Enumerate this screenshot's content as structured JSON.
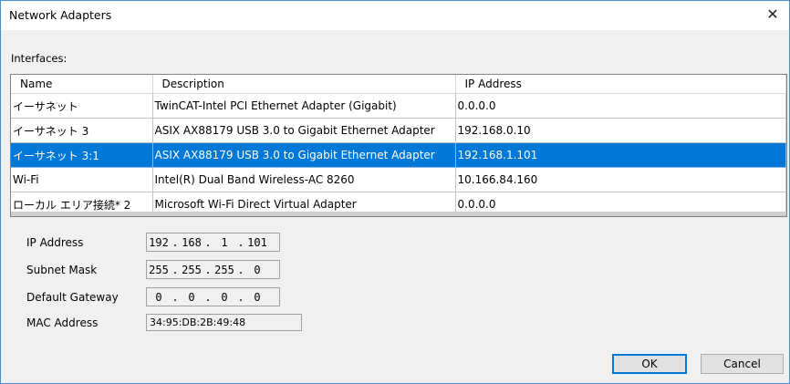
{
  "window": {
    "title": "Network Adapters",
    "close_glyph": "✕"
  },
  "interfaces": {
    "label": "Interfaces:",
    "columns": [
      "Name",
      "Description",
      "IP Address"
    ],
    "rows": [
      {
        "name": "イーサネット",
        "description": "TwinCAT-Intel PCI Ethernet Adapter (Gigabit)",
        "ip": "0.0.0.0",
        "selected": false
      },
      {
        "name": "イーサネット 3",
        "description": "ASIX AX88179 USB 3.0 to Gigabit Ethernet Adapter",
        "ip": "192.168.0.10",
        "selected": false
      },
      {
        "name": "イーサネット 3:1",
        "description": "ASIX AX88179 USB 3.0 to Gigabit Ethernet Adapter",
        "ip": "192.168.1.101",
        "selected": true
      },
      {
        "name": "Wi-Fi",
        "description": "Intel(R) Dual Band Wireless-AC 8260",
        "ip": "10.166.84.160",
        "selected": false
      },
      {
        "name": "ローカル エリア接続* 2",
        "description": "Microsoft Wi-Fi Direct Virtual Adapter",
        "ip": "0.0.0.0",
        "selected": false
      }
    ]
  },
  "details": {
    "ip_address": {
      "label": "IP Address",
      "octets": [
        "192",
        "168",
        "1",
        "101"
      ]
    },
    "subnet_mask": {
      "label": "Subnet Mask",
      "octets": [
        "255",
        "255",
        "255",
        "0"
      ]
    },
    "default_gateway": {
      "label": "Default Gateway",
      "octets": [
        "0",
        "0",
        "0",
        "0"
      ]
    },
    "mac_address": {
      "label": "MAC Address",
      "value": "34:95:DB:2B:49:48"
    }
  },
  "buttons": {
    "ok": "OK",
    "cancel": "Cancel"
  },
  "colors": {
    "selection": "#0078d7",
    "window_border": "#4a8fd4",
    "dialog_bg": "#f0f0f0"
  }
}
